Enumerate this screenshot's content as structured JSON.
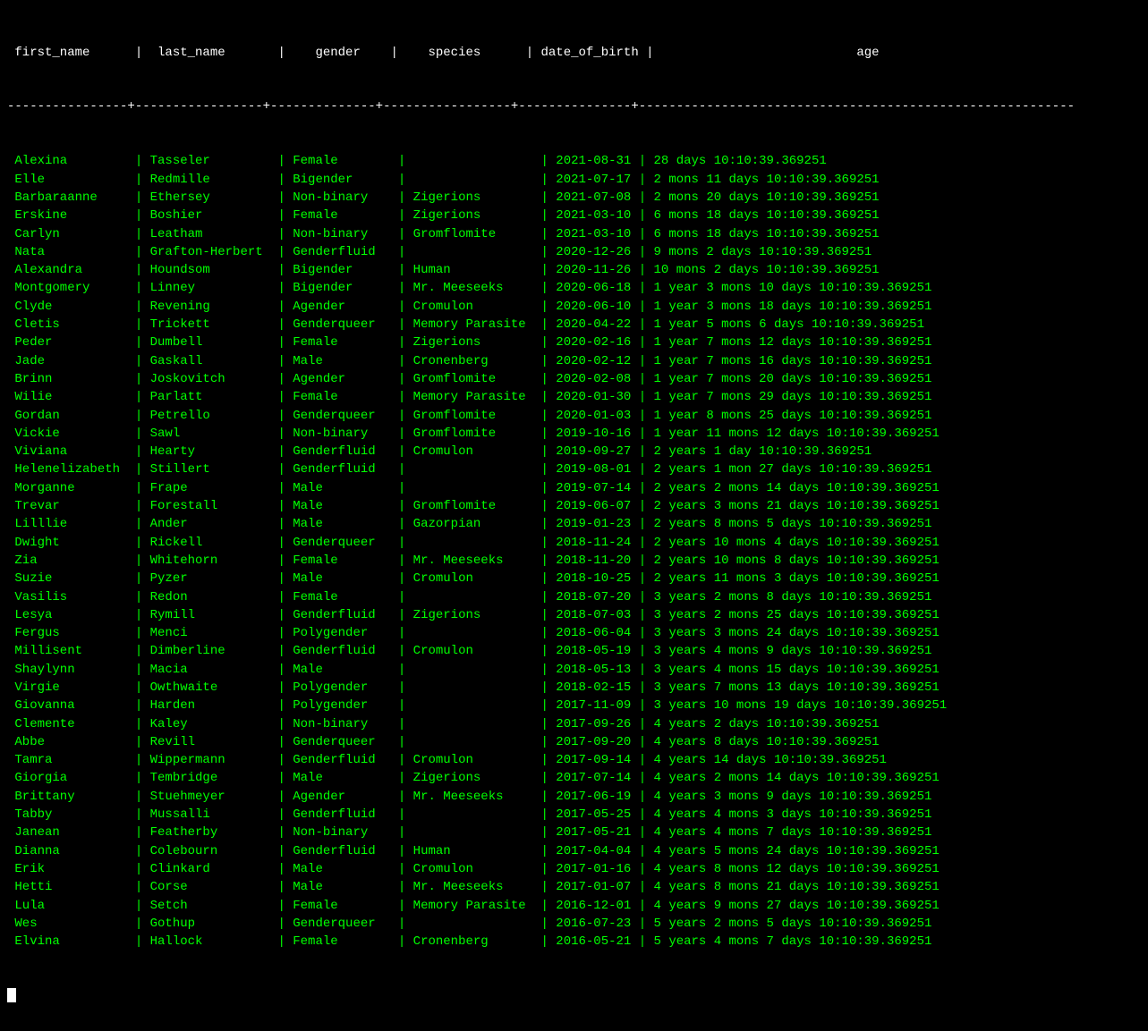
{
  "header": {
    "columns": " first_name      |  last_name       |    gender    |    species      | date_of_birth |                           age                            "
  },
  "separator": "----------------+-----------------+--------------+-----------------+---------------+----------------------------------------------------------",
  "rows": [
    {
      "first_name": "Alexina",
      "last_name": "Tasseler",
      "gender": "Female",
      "species": "",
      "dob": "2021-08-31",
      "age": "28 days 10:10:39.369251"
    },
    {
      "first_name": "Elle",
      "last_name": "Redmille",
      "gender": "Bigender",
      "species": "",
      "dob": "2021-07-17",
      "age": "2 mons 11 days 10:10:39.369251"
    },
    {
      "first_name": "Barbaraanne",
      "last_name": "Ethersey",
      "gender": "Non-binary",
      "species": "Zigerions",
      "dob": "2021-07-08",
      "age": "2 mons 20 days 10:10:39.369251"
    },
    {
      "first_name": "Erskine",
      "last_name": "Boshier",
      "gender": "Female",
      "species": "Zigerions",
      "dob": "2021-03-10",
      "age": "6 mons 18 days 10:10:39.369251"
    },
    {
      "first_name": "Carlyn",
      "last_name": "Leatham",
      "gender": "Non-binary",
      "species": "Gromflomite",
      "dob": "2021-03-10",
      "age": "6 mons 18 days 10:10:39.369251"
    },
    {
      "first_name": "Nata",
      "last_name": "Grafton-Herbert",
      "gender": "Genderfluid",
      "species": "",
      "dob": "2020-12-26",
      "age": "9 mons 2 days 10:10:39.369251"
    },
    {
      "first_name": "Alexandra",
      "last_name": "Houndsom",
      "gender": "Bigender",
      "species": "Human",
      "dob": "2020-11-26",
      "age": "10 mons 2 days 10:10:39.369251"
    },
    {
      "first_name": "Montgomery",
      "last_name": "Linney",
      "gender": "Bigender",
      "species": "Mr. Meeseeks",
      "dob": "2020-06-18",
      "age": "1 year 3 mons 10 days 10:10:39.369251"
    },
    {
      "first_name": "Clyde",
      "last_name": "Revening",
      "gender": "Agender",
      "species": "Cromulon",
      "dob": "2020-06-10",
      "age": "1 year 3 mons 18 days 10:10:39.369251"
    },
    {
      "first_name": "Cletis",
      "last_name": "Trickett",
      "gender": "Genderqueer",
      "species": "Memory Parasite",
      "dob": "2020-04-22",
      "age": "1 year 5 mons 6 days 10:10:39.369251"
    },
    {
      "first_name": "Peder",
      "last_name": "Dumbell",
      "gender": "Female",
      "species": "Zigerions",
      "dob": "2020-02-16",
      "age": "1 year 7 mons 12 days 10:10:39.369251"
    },
    {
      "first_name": "Jade",
      "last_name": "Gaskall",
      "gender": "Male",
      "species": "Cronenberg",
      "dob": "2020-02-12",
      "age": "1 year 7 mons 16 days 10:10:39.369251"
    },
    {
      "first_name": "Brinn",
      "last_name": "Joskovitch",
      "gender": "Agender",
      "species": "Gromflomite",
      "dob": "2020-02-08",
      "age": "1 year 7 mons 20 days 10:10:39.369251"
    },
    {
      "first_name": "Wilie",
      "last_name": "Parlatt",
      "gender": "Female",
      "species": "Memory Parasite",
      "dob": "2020-01-30",
      "age": "1 year 7 mons 29 days 10:10:39.369251"
    },
    {
      "first_name": "Gordan",
      "last_name": "Petrello",
      "gender": "Genderqueer",
      "species": "Gromflomite",
      "dob": "2020-01-03",
      "age": "1 year 8 mons 25 days 10:10:39.369251"
    },
    {
      "first_name": "Vickie",
      "last_name": "Sawl",
      "gender": "Non-binary",
      "species": "Gromflomite",
      "dob": "2019-10-16",
      "age": "1 year 11 mons 12 days 10:10:39.369251"
    },
    {
      "first_name": "Viviana",
      "last_name": "Hearty",
      "gender": "Genderfluid",
      "species": "Cromulon",
      "dob": "2019-09-27",
      "age": "2 years 1 day 10:10:39.369251"
    },
    {
      "first_name": "Helenelizabeth",
      "last_name": "Stillert",
      "gender": "Genderfluid",
      "species": "",
      "dob": "2019-08-01",
      "age": "2 years 1 mon 27 days 10:10:39.369251"
    },
    {
      "first_name": "Morganne",
      "last_name": "Frape",
      "gender": "Male",
      "species": "",
      "dob": "2019-07-14",
      "age": "2 years 2 mons 14 days 10:10:39.369251"
    },
    {
      "first_name": "Trevar",
      "last_name": "Forestall",
      "gender": "Male",
      "species": "Gromflomite",
      "dob": "2019-06-07",
      "age": "2 years 3 mons 21 days 10:10:39.369251"
    },
    {
      "first_name": "Lilllie",
      "last_name": "Ander",
      "gender": "Male",
      "species": "Gazorpian",
      "dob": "2019-01-23",
      "age": "2 years 8 mons 5 days 10:10:39.369251"
    },
    {
      "first_name": "Dwight",
      "last_name": "Rickell",
      "gender": "Genderqueer",
      "species": "",
      "dob": "2018-11-24",
      "age": "2 years 10 mons 4 days 10:10:39.369251"
    },
    {
      "first_name": "Zia",
      "last_name": "Whitehorn",
      "gender": "Female",
      "species": "Mr. Meeseeks",
      "dob": "2018-11-20",
      "age": "2 years 10 mons 8 days 10:10:39.369251"
    },
    {
      "first_name": "Suzie",
      "last_name": "Pyzer",
      "gender": "Male",
      "species": "Cromulon",
      "dob": "2018-10-25",
      "age": "2 years 11 mons 3 days 10:10:39.369251"
    },
    {
      "first_name": "Vasilis",
      "last_name": "Redon",
      "gender": "Female",
      "species": "",
      "dob": "2018-07-20",
      "age": "3 years 2 mons 8 days 10:10:39.369251"
    },
    {
      "first_name": "Lesya",
      "last_name": "Rymill",
      "gender": "Genderfluid",
      "species": "Zigerions",
      "dob": "2018-07-03",
      "age": "3 years 2 mons 25 days 10:10:39.369251"
    },
    {
      "first_name": "Fergus",
      "last_name": "Menci",
      "gender": "Polygender",
      "species": "",
      "dob": "2018-06-04",
      "age": "3 years 3 mons 24 days 10:10:39.369251"
    },
    {
      "first_name": "Millisent",
      "last_name": "Dimberline",
      "gender": "Genderfluid",
      "species": "Cromulon",
      "dob": "2018-05-19",
      "age": "3 years 4 mons 9 days 10:10:39.369251"
    },
    {
      "first_name": "Shaylynn",
      "last_name": "Macia",
      "gender": "Male",
      "species": "",
      "dob": "2018-05-13",
      "age": "3 years 4 mons 15 days 10:10:39.369251"
    },
    {
      "first_name": "Virgie",
      "last_name": "Owthwaite",
      "gender": "Polygender",
      "species": "",
      "dob": "2018-02-15",
      "age": "3 years 7 mons 13 days 10:10:39.369251"
    },
    {
      "first_name": "Giovanna",
      "last_name": "Harden",
      "gender": "Polygender",
      "species": "",
      "dob": "2017-11-09",
      "age": "3 years 10 mons 19 days 10:10:39.369251"
    },
    {
      "first_name": "Clemente",
      "last_name": "Kaley",
      "gender": "Non-binary",
      "species": "",
      "dob": "2017-09-26",
      "age": "4 years 2 days 10:10:39.369251"
    },
    {
      "first_name": "Abbe",
      "last_name": "Revill",
      "gender": "Genderqueer",
      "species": "",
      "dob": "2017-09-20",
      "age": "4 years 8 days 10:10:39.369251"
    },
    {
      "first_name": "Tamra",
      "last_name": "Wippermann",
      "gender": "Genderfluid",
      "species": "Cromulon",
      "dob": "2017-09-14",
      "age": "4 years 14 days 10:10:39.369251"
    },
    {
      "first_name": "Giorgia",
      "last_name": "Tembridge",
      "gender": "Male",
      "species": "Zigerions",
      "dob": "2017-07-14",
      "age": "4 years 2 mons 14 days 10:10:39.369251"
    },
    {
      "first_name": "Brittany",
      "last_name": "Stuehmeyer",
      "gender": "Agender",
      "species": "Mr. Meeseeks",
      "dob": "2017-06-19",
      "age": "4 years 3 mons 9 days 10:10:39.369251"
    },
    {
      "first_name": "Tabby",
      "last_name": "Mussalli",
      "gender": "Genderfluid",
      "species": "",
      "dob": "2017-05-25",
      "age": "4 years 4 mons 3 days 10:10:39.369251"
    },
    {
      "first_name": "Janean",
      "last_name": "Featherby",
      "gender": "Non-binary",
      "species": "",
      "dob": "2017-05-21",
      "age": "4 years 4 mons 7 days 10:10:39.369251"
    },
    {
      "first_name": "Dianna",
      "last_name": "Colebourn",
      "gender": "Genderfluid",
      "species": "Human",
      "dob": "2017-04-04",
      "age": "4 years 5 mons 24 days 10:10:39.369251"
    },
    {
      "first_name": "Erik",
      "last_name": "Clinkard",
      "gender": "Male",
      "species": "Cromulon",
      "dob": "2017-01-16",
      "age": "4 years 8 mons 12 days 10:10:39.369251"
    },
    {
      "first_name": "Hetti",
      "last_name": "Corse",
      "gender": "Male",
      "species": "Mr. Meeseeks",
      "dob": "2017-01-07",
      "age": "4 years 8 mons 21 days 10:10:39.369251"
    },
    {
      "first_name": "Lula",
      "last_name": "Setch",
      "gender": "Female",
      "species": "Memory Parasite",
      "dob": "2016-12-01",
      "age": "4 years 9 mons 27 days 10:10:39.369251"
    },
    {
      "first_name": "Wes",
      "last_name": "Gothup",
      "gender": "Genderqueer",
      "species": "",
      "dob": "2016-07-23",
      "age": "5 years 2 mons 5 days 10:10:39.369251"
    },
    {
      "first_name": "Elvina",
      "last_name": "Hallock",
      "gender": "Female",
      "species": "Cronenberg",
      "dob": "2016-05-21",
      "age": "5 years 4 mons 7 days 10:10:39.369251"
    }
  ],
  "cursor": ":"
}
